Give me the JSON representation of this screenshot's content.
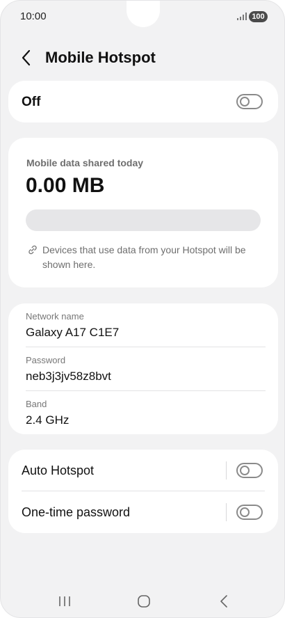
{
  "status_bar": {
    "time": "10:00",
    "battery": "100"
  },
  "header": {
    "title": "Mobile Hotspot",
    "back_icon": "chevron-left-icon"
  },
  "hotspot_toggle": {
    "label": "Off",
    "state": "off"
  },
  "usage": {
    "caption": "Mobile data shared today",
    "value": "0.00 MB",
    "progress_percent": 0,
    "info_icon": "link-icon",
    "info_text": "Devices that use data from your Hotspot will be shown here."
  },
  "network": {
    "name_label": "Network name",
    "name_value": "Galaxy A17 C1E7",
    "password_label": "Password",
    "password_value": "neb3j3jv58z8bvt",
    "band_label": "Band",
    "band_value": "2.4 GHz"
  },
  "options": {
    "auto_hotspot_label": "Auto Hotspot",
    "auto_hotspot_state": "off",
    "one_time_password_label": "One-time password",
    "one_time_password_state": "off"
  },
  "nav_bar": {
    "recents_icon": "recents-icon",
    "home_icon": "home-icon",
    "back_icon": "back-icon"
  },
  "colors": {
    "background": "#f2f2f3",
    "card": "#ffffff",
    "toggle_off": "#8e8e8e",
    "progress_track": "#e6e6e8",
    "secondary_text": "#6e6e6e"
  }
}
